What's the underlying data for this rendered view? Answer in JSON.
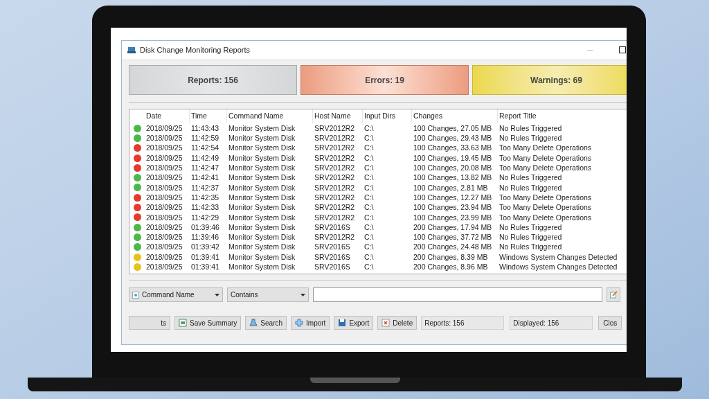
{
  "window": {
    "title": "Disk Change Monitoring Reports"
  },
  "summary": [
    {
      "kind": "reports",
      "label": "Reports: 156"
    },
    {
      "kind": "errors",
      "label": "Errors: 19"
    },
    {
      "kind": "warnings",
      "label": "Warnings: 69"
    }
  ],
  "table": {
    "columns": [
      "Date",
      "Time",
      "Command Name",
      "Host Name",
      "Input Dirs",
      "Changes",
      "Report Title"
    ],
    "rows": [
      {
        "color": "#4cb84a",
        "cells": [
          "2018/09/25",
          "11:43:43",
          "Monitor System Disk",
          "SRV2012R2",
          "C:\\",
          "100 Changes, 27.05 MB",
          "No Rules Triggered"
        ]
      },
      {
        "color": "#4cb84a",
        "cells": [
          "2018/09/25",
          "11:42:59",
          "Monitor System Disk",
          "SRV2012R2",
          "C:\\",
          "100 Changes, 29.43 MB",
          "No Rules Triggered"
        ]
      },
      {
        "color": "#e53a2e",
        "cells": [
          "2018/09/25",
          "11:42:54",
          "Monitor System Disk",
          "SRV2012R2",
          "C:\\",
          "100 Changes, 33.63 MB",
          "Too Many Delete Operations"
        ]
      },
      {
        "color": "#e53a2e",
        "cells": [
          "2018/09/25",
          "11:42:49",
          "Monitor System Disk",
          "SRV2012R2",
          "C:\\",
          "100 Changes, 19.45 MB",
          "Too Many Delete Operations"
        ]
      },
      {
        "color": "#e53a2e",
        "cells": [
          "2018/09/25",
          "11:42:47",
          "Monitor System Disk",
          "SRV2012R2",
          "C:\\",
          "100 Changes, 20.08 MB",
          "Too Many Delete Operations"
        ]
      },
      {
        "color": "#4cb84a",
        "cells": [
          "2018/09/25",
          "11:42:41",
          "Monitor System Disk",
          "SRV2012R2",
          "C:\\",
          "100 Changes, 13.82 MB",
          "No Rules Triggered"
        ]
      },
      {
        "color": "#4cb84a",
        "cells": [
          "2018/09/25",
          "11:42:37",
          "Monitor System Disk",
          "SRV2012R2",
          "C:\\",
          "100 Changes, 2.81 MB",
          "No Rules Triggered"
        ]
      },
      {
        "color": "#e53a2e",
        "cells": [
          "2018/09/25",
          "11:42:35",
          "Monitor System Disk",
          "SRV2012R2",
          "C:\\",
          "100 Changes, 12.27 MB",
          "Too Many Delete Operations"
        ]
      },
      {
        "color": "#e53a2e",
        "cells": [
          "2018/09/25",
          "11:42:33",
          "Monitor System Disk",
          "SRV2012R2",
          "C:\\",
          "100 Changes, 23.94 MB",
          "Too Many Delete Operations"
        ]
      },
      {
        "color": "#e53a2e",
        "cells": [
          "2018/09/25",
          "11:42:29",
          "Monitor System Disk",
          "SRV2012R2",
          "C:\\",
          "100 Changes, 23.99 MB",
          "Too Many Delete Operations"
        ]
      },
      {
        "color": "#4cb84a",
        "cells": [
          "2018/09/25",
          "01:39:46",
          "Monitor System Disk",
          "SRV2016S",
          "C:\\",
          "200 Changes, 17.94 MB",
          "No Rules Triggered"
        ]
      },
      {
        "color": "#4cb84a",
        "cells": [
          "2018/09/25",
          "11:39:46",
          "Monitor System Disk",
          "SRV2012R2",
          "C:\\",
          "100 Changes, 37.72 MB",
          "No Rules Triggered"
        ]
      },
      {
        "color": "#4cb84a",
        "cells": [
          "2018/09/25",
          "01:39:42",
          "Monitor System Disk",
          "SRV2016S",
          "C:\\",
          "200 Changes, 24.48 MB",
          "No Rules Triggered"
        ]
      },
      {
        "color": "#e8c21c",
        "cells": [
          "2018/09/25",
          "01:39:41",
          "Monitor System Disk",
          "SRV2016S",
          "C:\\",
          "200 Changes, 8.39 MB",
          "Windows System Changes Detected"
        ]
      },
      {
        "color": "#e8c21c",
        "cells": [
          "2018/09/25",
          "01:39:41",
          "Monitor System Disk",
          "SRV2016S",
          "C:\\",
          "200 Changes, 8.96 MB",
          "Windows System Changes Detected"
        ]
      }
    ]
  },
  "filter": {
    "field": "Command Name",
    "operator": "Contains"
  },
  "buttons": [
    {
      "kind": "plain",
      "label": "ts"
    },
    {
      "kind": "summary",
      "label": "Save Summary"
    },
    {
      "kind": "search",
      "label": "Search"
    },
    {
      "kind": "import",
      "label": "Import"
    },
    {
      "kind": "export",
      "label": "Export"
    },
    {
      "kind": "delete",
      "label": "Delete"
    }
  ],
  "status": [
    "Reports: 156",
    "Displayed: 156"
  ],
  "close_button": "Clos"
}
